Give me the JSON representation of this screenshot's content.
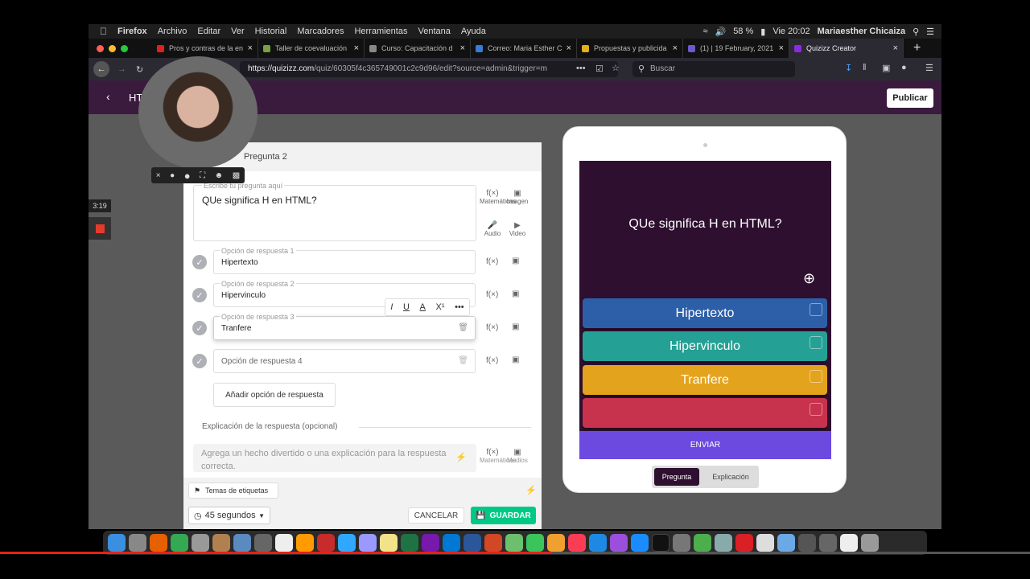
{
  "menubar": {
    "apple": "",
    "items": [
      "Firefox",
      "Archivo",
      "Editar",
      "Ver",
      "Historial",
      "Marcadores",
      "Herramientas",
      "Ventana",
      "Ayuda"
    ],
    "battery": "58 %",
    "clock": "Vie 20:02",
    "user": "Mariaesther Chicaiza"
  },
  "tabs": [
    {
      "label": "Pros y contras de la en",
      "color": "#e02020"
    },
    {
      "label": "Taller de coevaluación",
      "color": "#7aa040"
    },
    {
      "label": "Curso: Capacitación d",
      "color": "#888888"
    },
    {
      "label": "Correo: Maria Esther C",
      "color": "#3a7bd5"
    },
    {
      "label": "Propuestas y publicida",
      "color": "#e0b020"
    },
    {
      "label": "(1) | 19 February, 2021",
      "color": "#6a5acd"
    },
    {
      "label": "Quizizz Creator",
      "color": "#8a2be2"
    }
  ],
  "nav": {
    "url_host": "https://quizizz.com",
    "url_path": "/quiz/60305f4c365749001c2c9d96/edit?source=admin&trigger=m",
    "search_placeholder": "Buscar"
  },
  "app": {
    "title": "HTML",
    "publish": "Publicar"
  },
  "recorder": {
    "time": "3:19"
  },
  "editor": {
    "header": "Pregunta 2",
    "question_placeholder": "Escribe tu pregunta aquí",
    "question": "QUe significa H en HTML?",
    "tools": {
      "math": "Matemáticas",
      "image": "Imagen",
      "audio": "Audio",
      "video": "Video"
    },
    "options": [
      {
        "label": "Opción de respuesta 1",
        "value": "Hipertexto"
      },
      {
        "label": "Opción de respuesta 2",
        "value": "Hipervinculo"
      },
      {
        "label": "Opción de respuesta 3",
        "value": "Tranfere"
      },
      {
        "label": "",
        "value": "Opción de respuesta 4"
      }
    ],
    "add_option": "Añadir opción de respuesta",
    "explanation_title": "Explicación de la respuesta (opcional)",
    "explanation_placeholder": "Agrega un hecho divertido o una explicación para la respuesta correcta.",
    "expl_tools": {
      "math": "Matemáticas",
      "media": "Medios"
    },
    "tags": "Temas de etiquetas",
    "time": "45 segundos",
    "cancel": "CANCELAR",
    "save": "GUARDAR"
  },
  "preview": {
    "question": "QUe significa H en HTML?",
    "answers": [
      {
        "text": "Hipertexto",
        "color": "#2d5fa8"
      },
      {
        "text": "Hipervinculo",
        "color": "#25a094"
      },
      {
        "text": "Tranfere",
        "color": "#e3a31d"
      },
      {
        "text": "",
        "color": "#c7324d"
      }
    ],
    "submit": "ENVIAR",
    "tab_question": "Pregunta",
    "tab_explanation": "Explicación"
  }
}
